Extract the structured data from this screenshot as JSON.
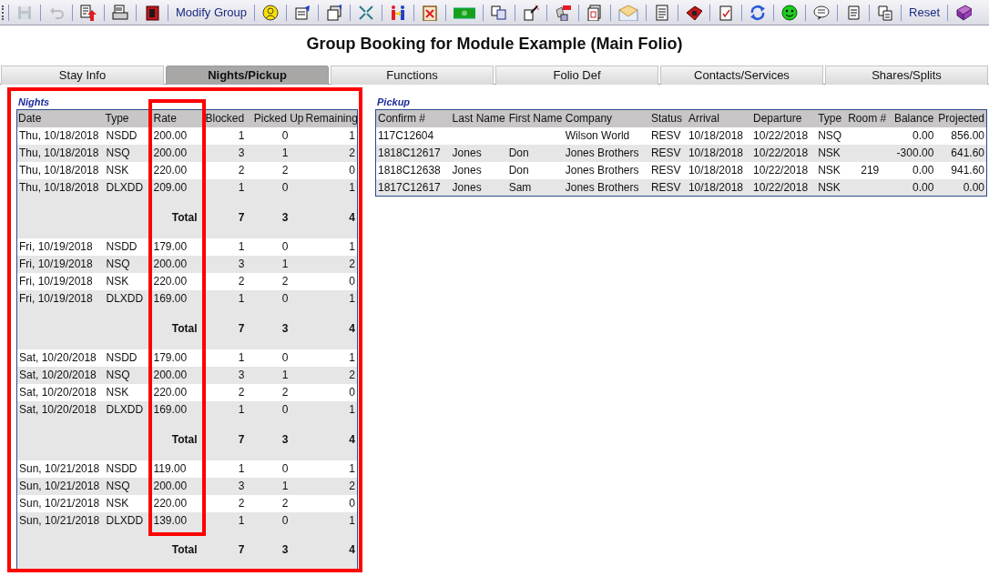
{
  "toolbar": [
    {
      "kind": "icon",
      "disabled": true
    },
    {
      "kind": "icon",
      "disabled": true
    },
    {
      "kind": "icon",
      "disabled": false
    },
    {
      "kind": "icon",
      "disabled": false
    },
    {
      "kind": "icon",
      "disabled": false
    },
    {
      "kind": "text",
      "label": "Modify Group"
    },
    {
      "kind": "icon",
      "disabled": false
    },
    {
      "kind": "icon",
      "disabled": false
    },
    {
      "kind": "icon",
      "disabled": false
    },
    {
      "kind": "icon",
      "disabled": false
    },
    {
      "kind": "icon",
      "disabled": false
    },
    {
      "kind": "icon",
      "disabled": false
    },
    {
      "kind": "icon",
      "disabled": false
    },
    {
      "kind": "icon",
      "disabled": false
    },
    {
      "kind": "icon",
      "disabled": false
    },
    {
      "kind": "icon",
      "disabled": false
    },
    {
      "kind": "icon",
      "disabled": false
    },
    {
      "kind": "icon",
      "disabled": false
    },
    {
      "kind": "icon",
      "disabled": false
    },
    {
      "kind": "icon",
      "disabled": false
    },
    {
      "kind": "icon",
      "disabled": false
    },
    {
      "kind": "icon",
      "disabled": false
    },
    {
      "kind": "icon",
      "disabled": false
    },
    {
      "kind": "icon",
      "disabled": false
    },
    {
      "kind": "icon",
      "disabled": false
    },
    {
      "kind": "icon",
      "disabled": false
    },
    {
      "kind": "text",
      "label": "Reset"
    },
    {
      "kind": "icon",
      "disabled": false
    }
  ],
  "title": "Group Booking for Module Example (Main Folio)",
  "tabs": [
    {
      "label": "Stay Info",
      "selected": false
    },
    {
      "label": "Nights/Pickup",
      "selected": true
    },
    {
      "label": "Functions",
      "selected": false
    },
    {
      "label": "Folio Def",
      "selected": false
    },
    {
      "label": "Contacts/Services",
      "selected": false
    },
    {
      "label": "Shares/Splits",
      "selected": false
    }
  ],
  "nights": {
    "heading": "Nights",
    "highlighted": true,
    "rate_highlighted": true,
    "columns": [
      "Date",
      "Type",
      "Rate",
      "Blocked",
      "Picked Up",
      "Remaining"
    ],
    "groups": [
      {
        "rows": [
          [
            "Thu, 10/18/2018",
            "NSDD",
            "200.00",
            "1",
            "0",
            "1"
          ],
          [
            "Thu, 10/18/2018",
            "NSQ",
            "200.00",
            "3",
            "1",
            "2"
          ],
          [
            "Thu, 10/18/2018",
            "NSK",
            "220.00",
            "2",
            "2",
            "0"
          ],
          [
            "Thu, 10/18/2018",
            "DLXDD",
            "209.00",
            "1",
            "0",
            "1"
          ]
        ],
        "total": [
          "Total",
          "7",
          "3",
          "4"
        ]
      },
      {
        "rows": [
          [
            "Fri, 10/19/2018",
            "NSDD",
            "179.00",
            "1",
            "0",
            "1"
          ],
          [
            "Fri, 10/19/2018",
            "NSQ",
            "200.00",
            "3",
            "1",
            "2"
          ],
          [
            "Fri, 10/19/2018",
            "NSK",
            "220.00",
            "2",
            "2",
            "0"
          ],
          [
            "Fri, 10/19/2018",
            "DLXDD",
            "169.00",
            "1",
            "0",
            "1"
          ]
        ],
        "total": [
          "Total",
          "7",
          "3",
          "4"
        ]
      },
      {
        "rows": [
          [
            "Sat, 10/20/2018",
            "NSDD",
            "179.00",
            "1",
            "0",
            "1"
          ],
          [
            "Sat, 10/20/2018",
            "NSQ",
            "200.00",
            "3",
            "1",
            "2"
          ],
          [
            "Sat, 10/20/2018",
            "NSK",
            "220.00",
            "2",
            "2",
            "0"
          ],
          [
            "Sat, 10/20/2018",
            "DLXDD",
            "169.00",
            "1",
            "0",
            "1"
          ]
        ],
        "total": [
          "Total",
          "7",
          "3",
          "4"
        ]
      },
      {
        "rows": [
          [
            "Sun, 10/21/2018",
            "NSDD",
            "119.00",
            "1",
            "0",
            "1"
          ],
          [
            "Sun, 10/21/2018",
            "NSQ",
            "200.00",
            "3",
            "1",
            "2"
          ],
          [
            "Sun, 10/21/2018",
            "NSK",
            "220.00",
            "2",
            "2",
            "0"
          ],
          [
            "Sun, 10/21/2018",
            "DLXDD",
            "139.00",
            "1",
            "0",
            "1"
          ]
        ],
        "total": [
          "Total",
          "7",
          "3",
          "4"
        ]
      }
    ]
  },
  "pickup": {
    "heading": "Pickup",
    "columns": [
      "Confirm #",
      "Last Name",
      "First Name",
      "Company",
      "Status",
      "Arrival",
      "Departure",
      "Type",
      "Room #",
      "Balance",
      "Projected"
    ],
    "rows": [
      [
        "117C12604",
        "",
        "",
        "Wilson World",
        "RESV",
        "10/18/2018",
        "10/22/2018",
        "NSQ",
        "",
        "0.00",
        "856.00"
      ],
      [
        "1818C12617",
        "Jones",
        "Don",
        "Jones Brothers",
        "RESV",
        "10/18/2018",
        "10/22/2018",
        "NSK",
        "",
        "-300.00",
        "641.60"
      ],
      [
        "1818C12638",
        "Jones",
        "Don",
        "Jones Brothers",
        "RESV",
        "10/18/2018",
        "10/22/2018",
        "NSK",
        "219",
        "0.00",
        "941.60"
      ],
      [
        "1817C12617",
        "Jones",
        "Sam",
        "Jones Brothers",
        "RESV",
        "10/18/2018",
        "10/22/2018",
        "NSK",
        "",
        "0.00",
        "0.00"
      ]
    ]
  }
}
